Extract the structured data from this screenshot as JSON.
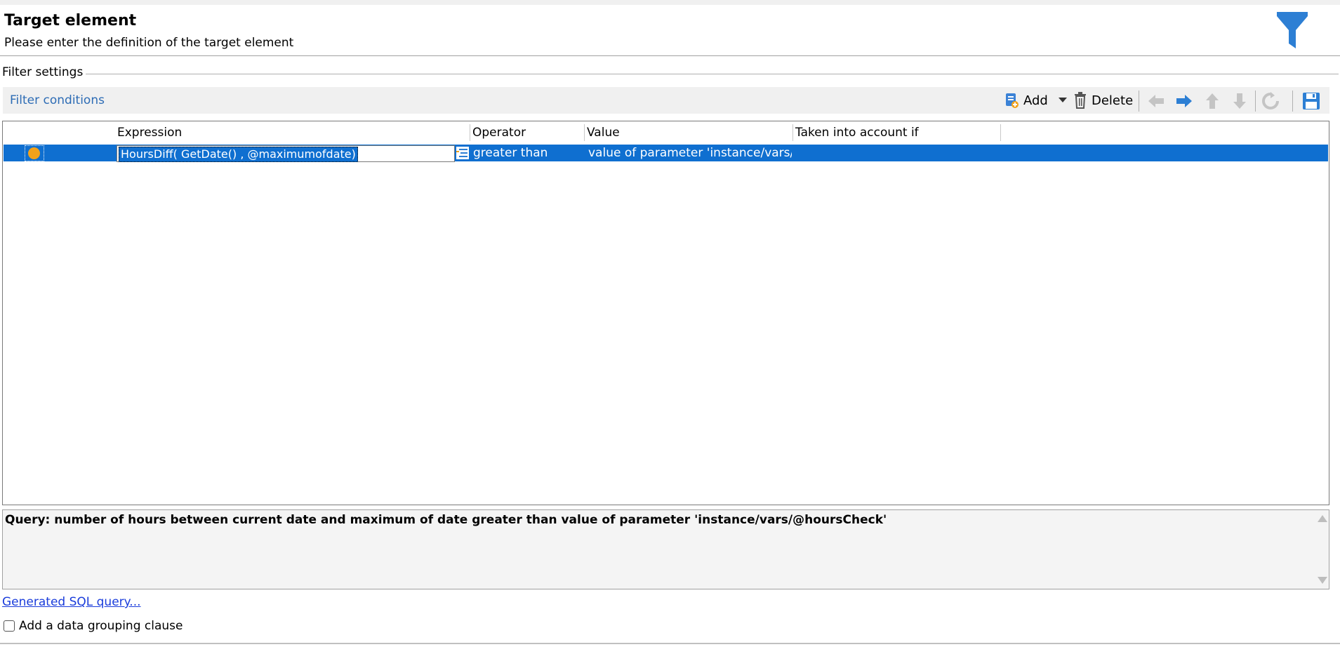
{
  "header": {
    "title": "Target element",
    "subtitle": "Please enter the definition of the target element",
    "icon": "filter-funnel-icon",
    "icon_color": "#2d7fd4"
  },
  "filter_settings": {
    "legend": "Filter settings"
  },
  "toolbar": {
    "title": "Filter conditions",
    "add_label": "Add",
    "delete_label": "Delete",
    "icons": [
      "add-icon",
      "dropdown-arrow-icon",
      "trash-icon",
      "arrow-left-icon",
      "arrow-right-icon",
      "arrow-up-icon",
      "arrow-down-icon",
      "refresh-icon",
      "save-icon"
    ],
    "accent_color": "#2d6cb5"
  },
  "grid": {
    "columns": [
      "Expression",
      "Operator",
      "Value",
      "Taken into account if"
    ],
    "rows": [
      {
        "expression": "HoursDiff( GetDate() , @maximumofdate)",
        "operator": "greater than",
        "value": "value of parameter 'instance/vars/@h",
        "condition": ""
      }
    ],
    "selection_color": "#0f6fd0",
    "bullet_color": "#f2a21b"
  },
  "query": {
    "text": "Query: number of hours between current date and maximum of date greater than value of parameter 'instance/vars/@hoursCheck'"
  },
  "links": {
    "sql": "Generated SQL query..."
  },
  "options": {
    "grouping_label": "Add a data grouping clause",
    "grouping_checked": false
  }
}
